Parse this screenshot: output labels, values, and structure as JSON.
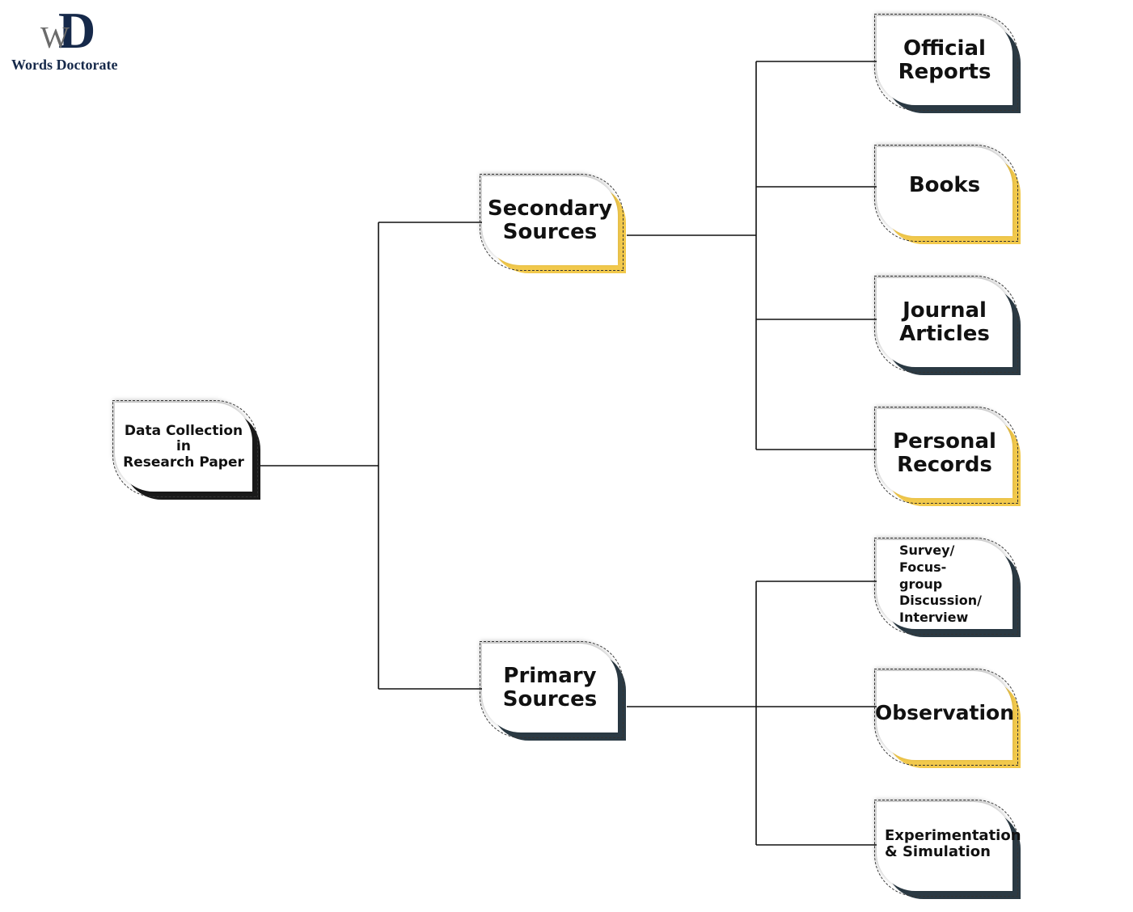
{
  "logo": {
    "mark_letters": [
      "W",
      "D"
    ],
    "name": "Words Doctorate"
  },
  "colors": {
    "dark": "#2b3a44",
    "yellow": "#f2c94c",
    "black": "#1a1a1a",
    "line": "#111111"
  },
  "diagram": {
    "root": {
      "id": "root",
      "label": "Data Collection\nin\nResearch Paper",
      "accent": "black"
    },
    "branches": [
      {
        "id": "secondary",
        "label": "Secondary\nSources",
        "accent": "yellow",
        "children": [
          {
            "id": "official-reports",
            "label": "Official\nReports",
            "accent": "dark"
          },
          {
            "id": "books",
            "label": "Books",
            "accent": "yellow"
          },
          {
            "id": "journal-articles",
            "label": "Journal\nArticles",
            "accent": "dark"
          },
          {
            "id": "personal-records",
            "label": "Personal\nRecords",
            "accent": "yellow"
          }
        ]
      },
      {
        "id": "primary",
        "label": "Primary\nSources",
        "accent": "dark",
        "children": [
          {
            "id": "survey",
            "label": "Survey/ Focus-\ngroup\nDiscussion/\nInterview",
            "accent": "dark"
          },
          {
            "id": "observation",
            "label": "Observation",
            "accent": "yellow"
          },
          {
            "id": "experimentation",
            "label": "Experimentation\n& Simulation",
            "accent": "dark"
          }
        ]
      }
    ]
  }
}
